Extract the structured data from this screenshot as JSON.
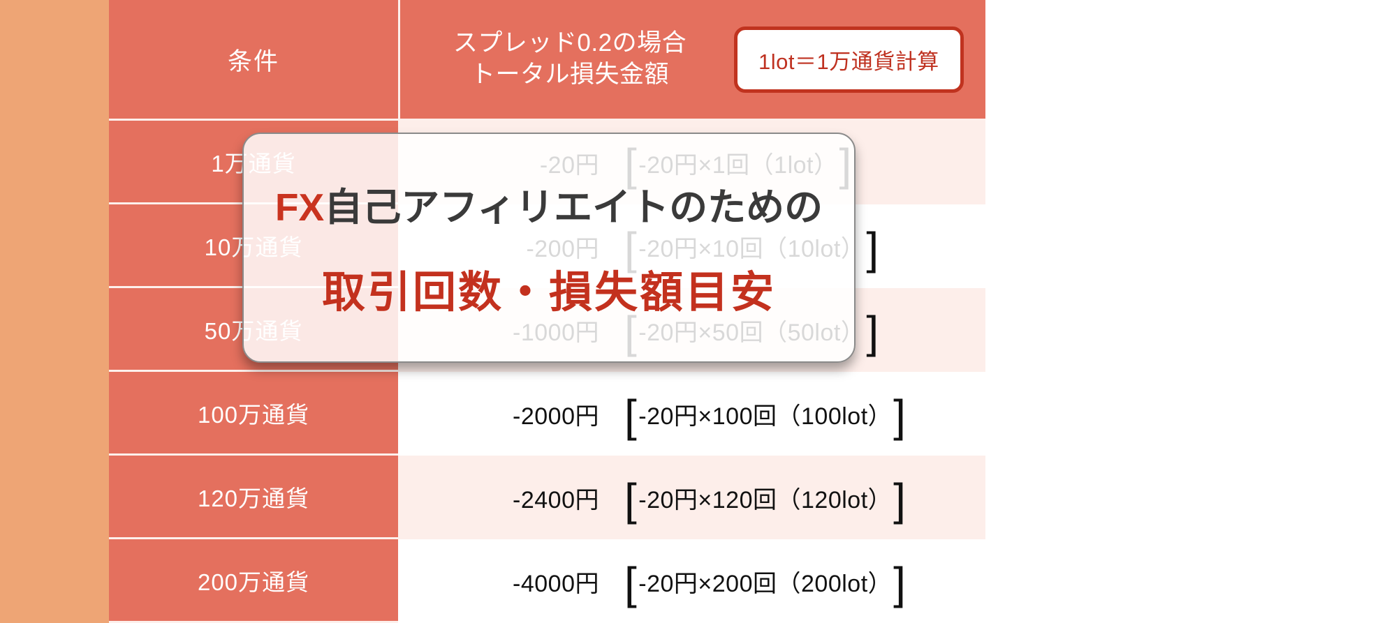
{
  "theme": {
    "page_background": "#eea575",
    "table_accent": "#e4705e",
    "row_alt": "#fdeeea",
    "row_base": "#ffffff",
    "badge_border": "#c0331f",
    "badge_text": "#bf3120",
    "overlay_accent": "#c3311e",
    "overlay_text": "#3a3a3a"
  },
  "table": {
    "header": {
      "condition_label": "条件",
      "value_label": "スプレッド0.2の場合\nトータル損失金額",
      "badge_label": "1lot＝1万通貨計算"
    },
    "rows": [
      {
        "condition": "1万通貨",
        "amount": "-20円",
        "bracket_open": "[",
        "detail": "-20円×1回（1lot）",
        "bracket_close": "]"
      },
      {
        "condition": "10万通貨",
        "amount": "-200円",
        "bracket_open": "[",
        "detail": "-20円×10回（10lot）",
        "bracket_close": "]"
      },
      {
        "condition": "50万通貨",
        "amount": "-1000円",
        "bracket_open": "[",
        "detail": "-20円×50回（50lot）",
        "bracket_close": "]"
      },
      {
        "condition": "100万通貨",
        "amount": "-2000円",
        "bracket_open": "[",
        "detail": "-20円×100回（100lot）",
        "bracket_close": "]"
      },
      {
        "condition": "120万通貨",
        "amount": "-2400円",
        "bracket_open": "[",
        "detail": "-20円×120回（120lot）",
        "bracket_close": "]"
      },
      {
        "condition": "200万通貨",
        "amount": "-4000円",
        "bracket_open": "[",
        "detail": "-20円×200回（200lot）",
        "bracket_close": "]"
      }
    ]
  },
  "overlay": {
    "line1_accent": "FX",
    "line1_rest": "自己アフィリエイトのための",
    "line2": "取引回数・損失額目安"
  }
}
